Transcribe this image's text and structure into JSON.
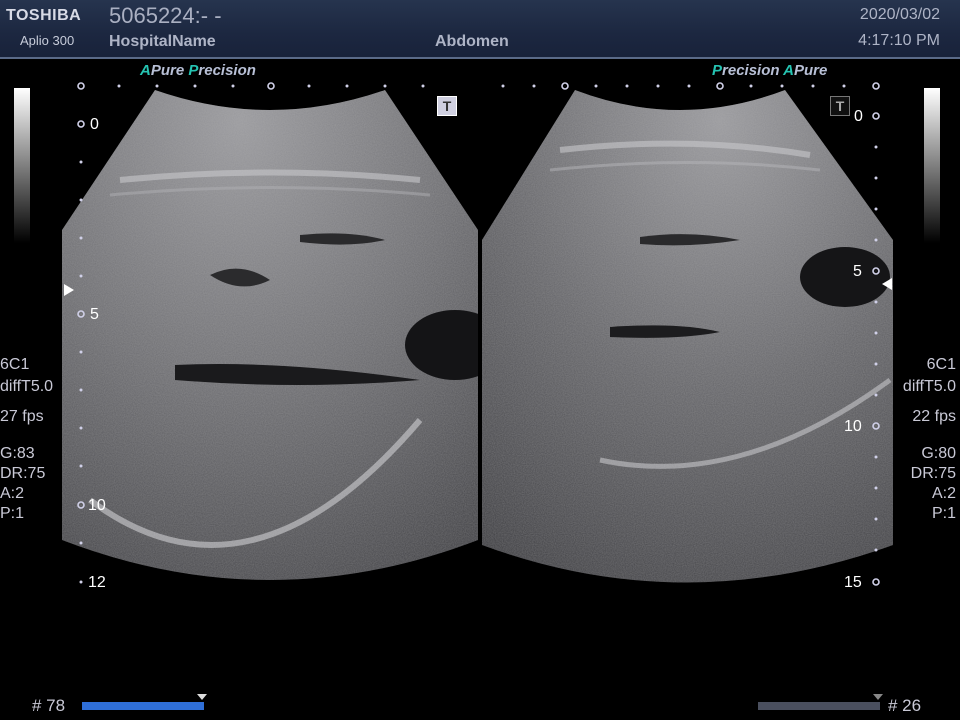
{
  "header": {
    "brand": "TOSHIBA",
    "model": "Aplio 300",
    "patient_id": "5065224:- -",
    "hospital": "HospitalName",
    "exam": "Abdomen",
    "date": "2020/03/02",
    "time": "4:17:10 PM"
  },
  "left_panel": {
    "probe_label": {
      "a": "A",
      "pure": "Pure",
      "p": "P",
      "precision": "recision"
    },
    "t_icon": "T",
    "depth_marks": [
      "0",
      "5",
      "10",
      "12"
    ],
    "settings": [
      "6C1",
      "diffT5.0",
      "27 fps",
      "G:83",
      "DR:75",
      "A:2",
      "P:1"
    ],
    "frame": "# 78",
    "cine_progress": 1.0
  },
  "right_panel": {
    "probe_label": {
      "p": "P",
      "precision": "recision",
      "a": "A",
      "pure": "Pure"
    },
    "t_icon": "T",
    "depth_marks": [
      "0",
      "5",
      "10",
      "15"
    ],
    "settings": [
      "6C1",
      "diffT5.0",
      "22 fps",
      "G:80",
      "DR:75",
      "A:2",
      "P:1"
    ],
    "frame": "# 26",
    "cine_progress": 1.0
  },
  "colors": {
    "header_bg": "#1c2740",
    "accent_teal": "#25c4b2",
    "cine_active": "#2f6fd8",
    "cine_inactive": "#4a4f5e"
  }
}
